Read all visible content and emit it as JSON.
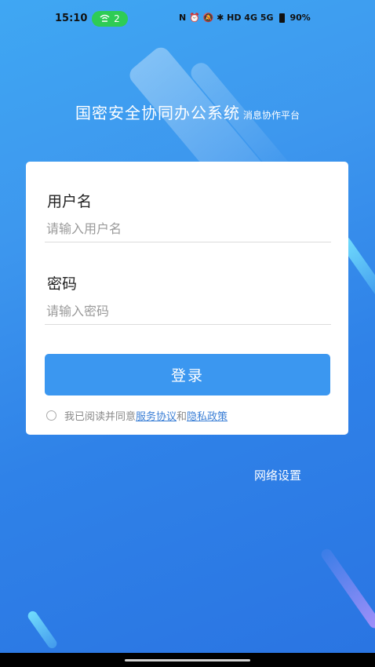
{
  "status_bar": {
    "time": "15:10",
    "wifi_count": "2",
    "icons_text": "N  ⏰  🔕  ✱  HD  4G  5G",
    "battery_percent": "90%"
  },
  "header": {
    "title": "国密安全协同办公系统",
    "subtitle": "消息协作平台"
  },
  "login_form": {
    "username_label": "用户名",
    "username_placeholder": "请输入用户名",
    "password_label": "密码",
    "password_placeholder": "请输入密码",
    "login_button_label": "登录",
    "agreement_prefix": "我已阅读并同意",
    "service_agreement_link": "服务协议",
    "agreement_and": "和",
    "privacy_policy_link": "隐私政策"
  },
  "footer": {
    "network_settings_label": "网络设置"
  },
  "colors": {
    "accent": "#3b97f0",
    "background_top": "#3fa7f3",
    "background_bottom": "#2a74e2",
    "wifi_pill": "#2ecc55",
    "link": "#3b7fd6"
  }
}
